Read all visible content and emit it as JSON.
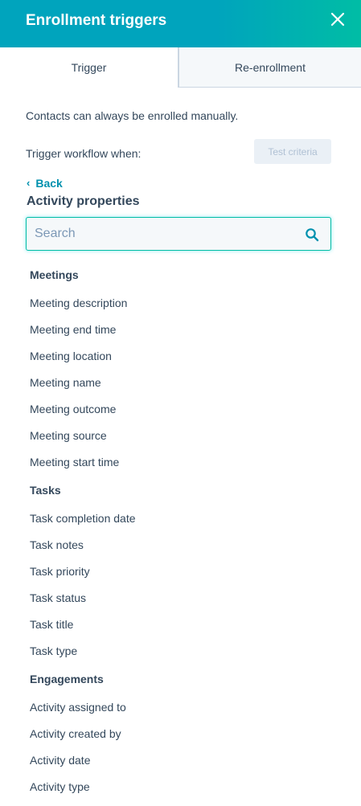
{
  "header": {
    "title": "Enrollment triggers"
  },
  "tabs": [
    {
      "label": "Trigger"
    },
    {
      "label": "Re-enrollment"
    }
  ],
  "manual_note": "Contacts can always be enrolled manually.",
  "trigger_label": "Trigger workflow when:",
  "test_button": "Test criteria",
  "back_label": "Back",
  "section_title": "Activity properties",
  "search": {
    "placeholder": "Search",
    "value": ""
  },
  "groups": [
    {
      "heading": "Meetings",
      "items": [
        "Meeting description",
        "Meeting end time",
        "Meeting location",
        "Meeting name",
        "Meeting outcome",
        "Meeting source",
        "Meeting start time"
      ]
    },
    {
      "heading": "Tasks",
      "items": [
        "Task completion date",
        "Task notes",
        "Task priority",
        "Task status",
        "Task title",
        "Task type"
      ]
    },
    {
      "heading": "Engagements",
      "items": [
        "Activity assigned to",
        "Activity created by",
        "Activity date",
        "Activity type"
      ]
    }
  ],
  "colors": {
    "header_start": "#00a4bd",
    "header_end": "#00bda5",
    "link": "#0091ae",
    "text": "#33475b",
    "focus_border": "#00bda5"
  }
}
